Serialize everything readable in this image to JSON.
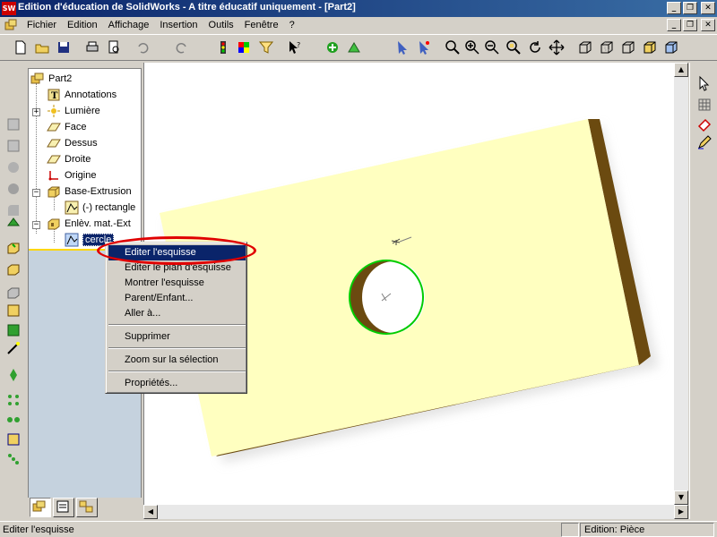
{
  "window": {
    "title": "Edition d'éducation de SolidWorks - A titre éducatif uniquement - [Part2]",
    "app_icon_text": "SW"
  },
  "menu": {
    "items": [
      "Fichier",
      "Edition",
      "Affichage",
      "Insertion",
      "Outils",
      "Fenêtre",
      "?"
    ]
  },
  "feature_tree": {
    "root": "Part2",
    "items": [
      {
        "label": "Annotations",
        "icon": "annotations-icon"
      },
      {
        "label": "Lumière",
        "icon": "lights-icon"
      },
      {
        "label": "Face",
        "icon": "plane-icon"
      },
      {
        "label": "Dessus",
        "icon": "plane-icon"
      },
      {
        "label": "Droite",
        "icon": "plane-icon"
      },
      {
        "label": "Origine",
        "icon": "origin-icon"
      },
      {
        "label": "Base-Extrusion",
        "icon": "extrude-icon"
      },
      {
        "label": "(-) rectangle",
        "icon": "sketch-icon"
      },
      {
        "label": "Enlèv. mat.-Ext",
        "icon": "cut-extrude-icon"
      },
      {
        "label": "cercle",
        "icon": "sketch-icon"
      }
    ]
  },
  "context_menu": {
    "items": [
      "Editer l'esquisse",
      "Editer le plan d'esquisse",
      "Montrer l'esquisse",
      "Parent/Enfant...",
      "Aller à...",
      "Supprimer",
      "Zoom sur la sélection",
      "Propriétés..."
    ],
    "highlighted_index": 0
  },
  "status": {
    "message": "Editer l'esquisse",
    "mode": "Edition: Pièce"
  },
  "colors": {
    "title_bar": "#0a246a",
    "part_face": "#ffffc0",
    "part_edge": "#6b4a10",
    "circle_highlight": "#00cc00",
    "annotation_ellipse": "#e00000"
  }
}
